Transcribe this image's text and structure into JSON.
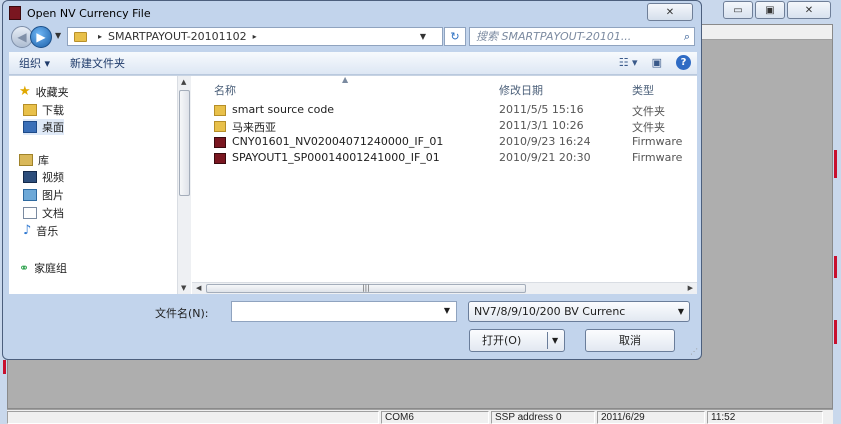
{
  "window": {
    "minimize_glyph": "▭",
    "maximize_glyph": "▣",
    "close_glyph": "✕"
  },
  "dialog": {
    "title": "Open NV Currency File",
    "close_glyph": "✕"
  },
  "address_bar": {
    "path": "SMARTPAYOUT-20101102",
    "separator": "▸"
  },
  "search": {
    "placeholder": "搜索 SMARTPAYOUT-20101..."
  },
  "command_bar": {
    "organize": "组织 ▾",
    "new_folder": "新建文件夹"
  },
  "nav_pane": {
    "favorites": "收藏夹",
    "downloads": "下载",
    "desktop": "桌面",
    "library": "库",
    "videos": "视频",
    "pictures": "图片",
    "documents": "文档",
    "music": "音乐",
    "homegroup": "家庭组"
  },
  "columns": {
    "name": "名称",
    "modified": "修改日期",
    "type": "类型"
  },
  "files": [
    {
      "name": "smart source code",
      "modified": "2011/5/5 15:16",
      "type": "文件夹",
      "icon": "folder-icon"
    },
    {
      "name": "马来西亚",
      "modified": "2011/3/1 10:26",
      "type": "文件夹",
      "icon": "folder-icon"
    },
    {
      "name": "CNY01601_NV02004071240000_IF_01",
      "modified": "2010/9/23 16:24",
      "type": "Firmware",
      "icon": "firmware-file-icon"
    },
    {
      "name": "SPAYOUT1_SP00014001241000_IF_01",
      "modified": "2010/9/21 20:30",
      "type": "Firmware",
      "icon": "firmware-file-icon"
    }
  ],
  "file_name": {
    "label": "文件名(N):",
    "value": ""
  },
  "file_type_filter": {
    "selected": "NV7/8/9/10/200 BV Currenc"
  },
  "buttons": {
    "open": "打开(O)",
    "cancel": "取消"
  },
  "statusbar": {
    "port": "COM6",
    "address": "SSP address 0",
    "date": "2011/6/29",
    "time": "11:52"
  },
  "colors": {
    "dialog_frame": "#c2d4ec",
    "app_client": "#aeaeae",
    "accent_red": "#c8102e",
    "folder": "#e8c04a"
  }
}
